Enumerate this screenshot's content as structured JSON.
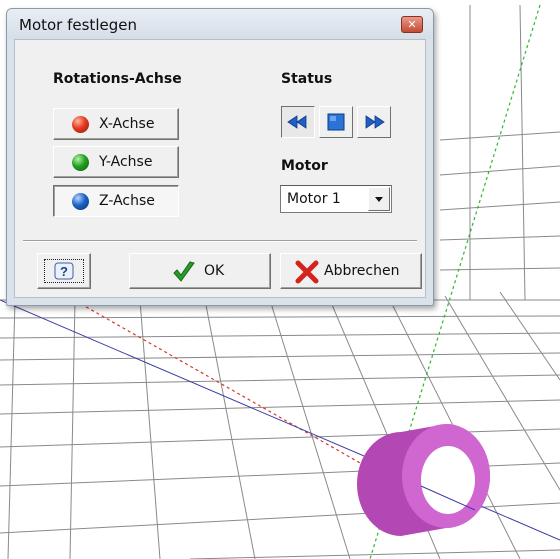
{
  "dialog": {
    "title": "Motor festlegen",
    "rotation_section": {
      "label": "Rotations-Achse",
      "axes": [
        {
          "label": "X-Achse",
          "color": "#e53a1c",
          "pressed": false
        },
        {
          "label": "Y-Achse",
          "color": "#22a020",
          "pressed": false
        },
        {
          "label": "Z-Achse",
          "color": "#1e63c7",
          "pressed": true
        }
      ]
    },
    "status_section": {
      "label": "Status",
      "buttons": [
        "rewind-icon",
        "stop-icon",
        "fast-forward-icon"
      ],
      "active": "rewind-icon"
    },
    "motor_section": {
      "label": "Motor",
      "selected": "Motor 1"
    },
    "footer": {
      "help_icon": "help-icon",
      "ok_label": "OK",
      "cancel_label": "Abbrechen"
    }
  },
  "scene": {
    "grid_color": "#8a8a8a",
    "x_axis_color": "#d23a2a",
    "y_axis_color": "#2fb52f",
    "z_axis_color": "#3b3ba8",
    "ring_color": "#c455c4"
  }
}
